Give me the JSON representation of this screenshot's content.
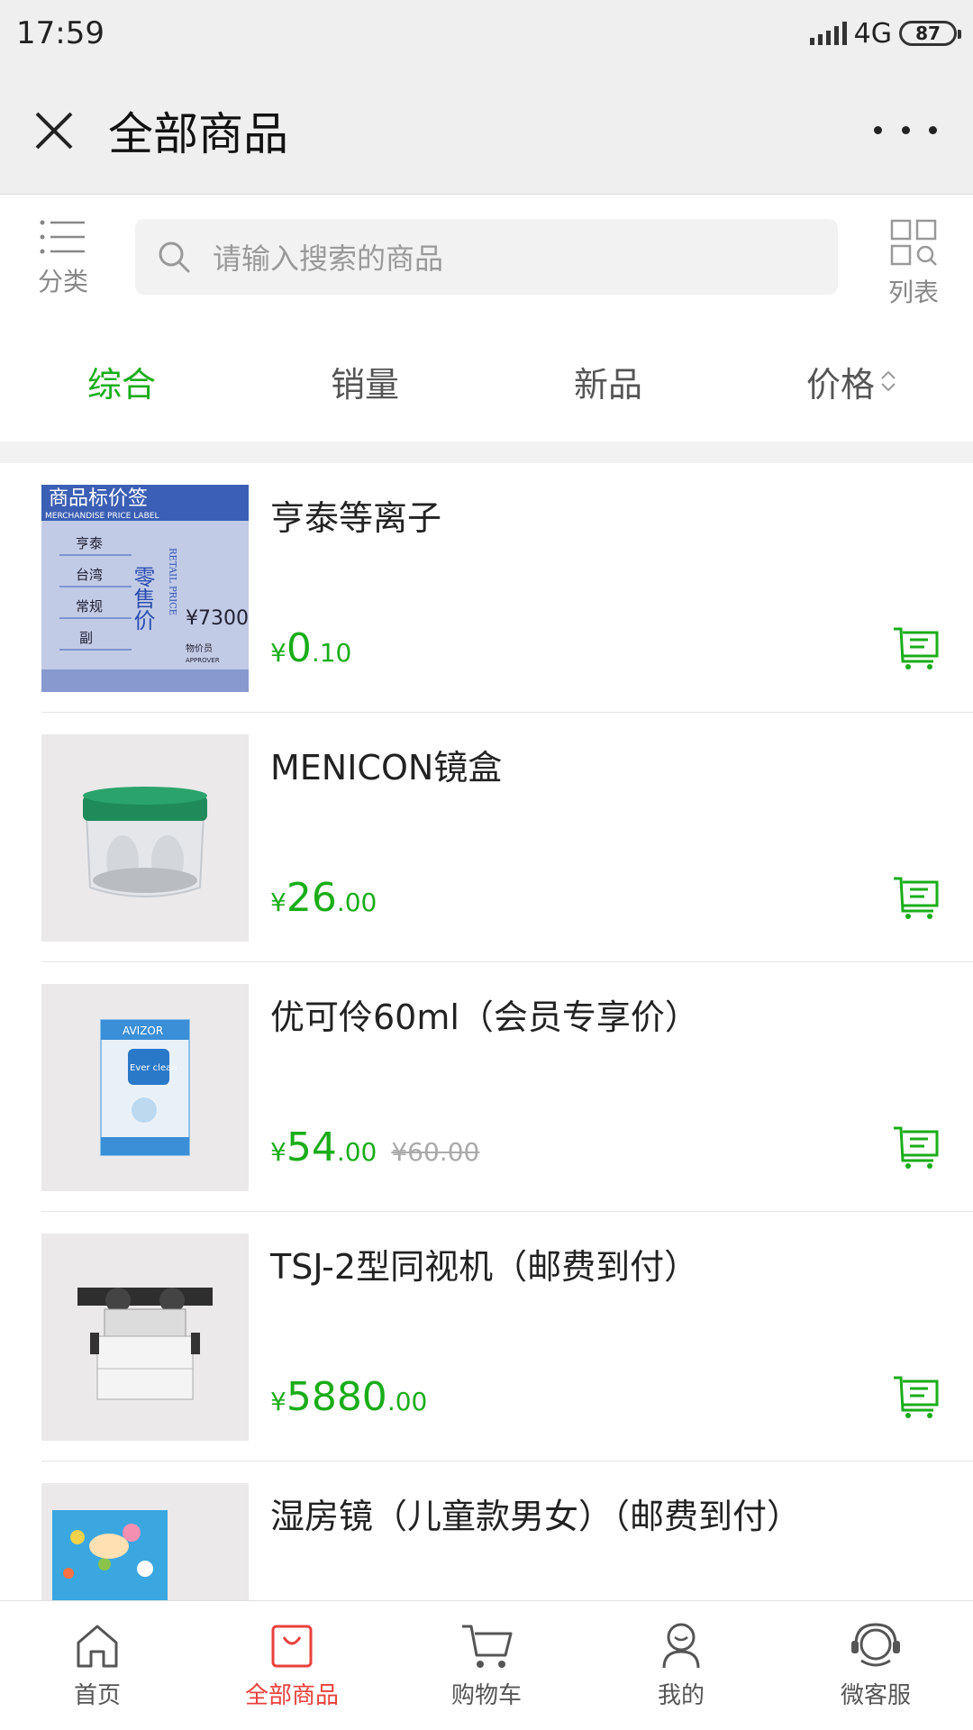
{
  "status_bar": {
    "time": "17:59",
    "network": "4G",
    "battery": "87"
  },
  "header": {
    "title": "全部商品"
  },
  "search": {
    "category_label": "分类",
    "placeholder": "请输入搜索的商品",
    "view_label": "列表"
  },
  "sort_tabs": [
    {
      "label": "综合",
      "active": true
    },
    {
      "label": "销量",
      "active": false
    },
    {
      "label": "新品",
      "active": false
    },
    {
      "label": "价格",
      "active": false
    }
  ],
  "products": [
    {
      "name": "亨泰等离子",
      "currency": "¥",
      "price_int": "0",
      "price_dec": ".10",
      "original_price": "",
      "image": {
        "header": "商品标价签",
        "sub": "MERCHANDISE PRICE LABEL",
        "rows": [
          "亨泰",
          "台湾",
          "常规",
          "副"
        ],
        "big": "零售价",
        "retail": "RETAIL PRICE",
        "amount": "¥7300",
        "approver": "物价员",
        "approver_en": "APPROVER"
      }
    },
    {
      "name": "MENICON镜盒",
      "currency": "¥",
      "price_int": "26",
      "price_dec": ".00",
      "original_price": ""
    },
    {
      "name": "优可伶60ml（会员专享价）",
      "currency": "¥",
      "price_int": "54",
      "price_dec": ".00",
      "original_price": "¥60.00",
      "image": {
        "brand": "AVIZOR",
        "product": "Ever clean"
      }
    },
    {
      "name": "TSJ-2型同视机（邮费到付）",
      "currency": "¥",
      "price_int": "5880",
      "price_dec": ".00",
      "original_price": ""
    },
    {
      "name": "湿房镜（儿童款男女）（邮费到付）",
      "currency": "",
      "price_int": "",
      "price_dec": "",
      "original_price": ""
    }
  ],
  "bottom_nav": [
    {
      "label": "首页",
      "icon": "home-icon",
      "active": false
    },
    {
      "label": "全部商品",
      "icon": "shopping-bag-icon",
      "active": true
    },
    {
      "label": "购物车",
      "icon": "cart-icon",
      "active": false
    },
    {
      "label": "我的",
      "icon": "user-icon",
      "active": false
    },
    {
      "label": "微客服",
      "icon": "headset-icon",
      "active": false
    }
  ],
  "colors": {
    "accent_green": "#1aad19",
    "active_red": "#e8413c",
    "header_bg": "#efefef"
  }
}
